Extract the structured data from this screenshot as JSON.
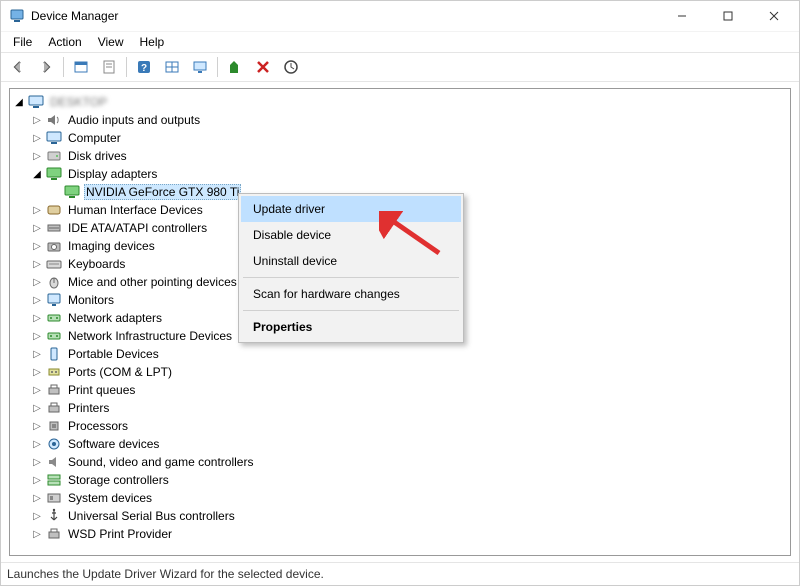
{
  "window": {
    "title": "Device Manager"
  },
  "menubar": [
    "File",
    "Action",
    "View",
    "Help"
  ],
  "tree": {
    "root": {
      "label": "DESKTOP"
    },
    "categories": [
      {
        "id": "audio",
        "label": "Audio inputs and outputs",
        "icon": "speaker"
      },
      {
        "id": "computer",
        "label": "Computer",
        "icon": "computer"
      },
      {
        "id": "disk",
        "label": "Disk drives",
        "icon": "disk"
      },
      {
        "id": "display",
        "label": "Display adapters",
        "icon": "display",
        "expanded": true,
        "children": [
          {
            "id": "gpu",
            "label": "NVIDIA GeForce GTX 980 Ti",
            "icon": "display",
            "selected": true
          }
        ]
      },
      {
        "id": "hid",
        "label": "Human Interface Devices",
        "icon": "hid"
      },
      {
        "id": "ide",
        "label": "IDE ATA/ATAPI controllers",
        "icon": "ide"
      },
      {
        "id": "imaging",
        "label": "Imaging devices",
        "icon": "camera"
      },
      {
        "id": "keyboards",
        "label": "Keyboards",
        "icon": "keyboard"
      },
      {
        "id": "mice",
        "label": "Mice and other pointing devices",
        "icon": "mouse"
      },
      {
        "id": "monitors",
        "label": "Monitors",
        "icon": "monitor"
      },
      {
        "id": "netadapters",
        "label": "Network adapters",
        "icon": "net"
      },
      {
        "id": "netinfra",
        "label": "Network Infrastructure Devices",
        "icon": "net"
      },
      {
        "id": "portable",
        "label": "Portable Devices",
        "icon": "portable"
      },
      {
        "id": "ports",
        "label": "Ports (COM & LPT)",
        "icon": "port"
      },
      {
        "id": "printq",
        "label": "Print queues",
        "icon": "printer"
      },
      {
        "id": "printers",
        "label": "Printers",
        "icon": "printer"
      },
      {
        "id": "processors",
        "label": "Processors",
        "icon": "cpu"
      },
      {
        "id": "software",
        "label": "Software devices",
        "icon": "software"
      },
      {
        "id": "sound",
        "label": "Sound, video and game controllers",
        "icon": "sound"
      },
      {
        "id": "storage",
        "label": "Storage controllers",
        "icon": "storage"
      },
      {
        "id": "system",
        "label": "System devices",
        "icon": "system"
      },
      {
        "id": "usb",
        "label": "Universal Serial Bus controllers",
        "icon": "usb"
      },
      {
        "id": "wsd",
        "label": "WSD Print Provider",
        "icon": "printer"
      }
    ]
  },
  "context_menu": {
    "items": [
      {
        "label": "Update driver",
        "highlight": true
      },
      {
        "label": "Disable device"
      },
      {
        "label": "Uninstall device"
      },
      {
        "separator": true
      },
      {
        "label": "Scan for hardware changes"
      },
      {
        "separator": true
      },
      {
        "label": "Properties",
        "bold": true
      }
    ]
  },
  "statusbar": {
    "text": "Launches the Update Driver Wizard for the selected device."
  }
}
